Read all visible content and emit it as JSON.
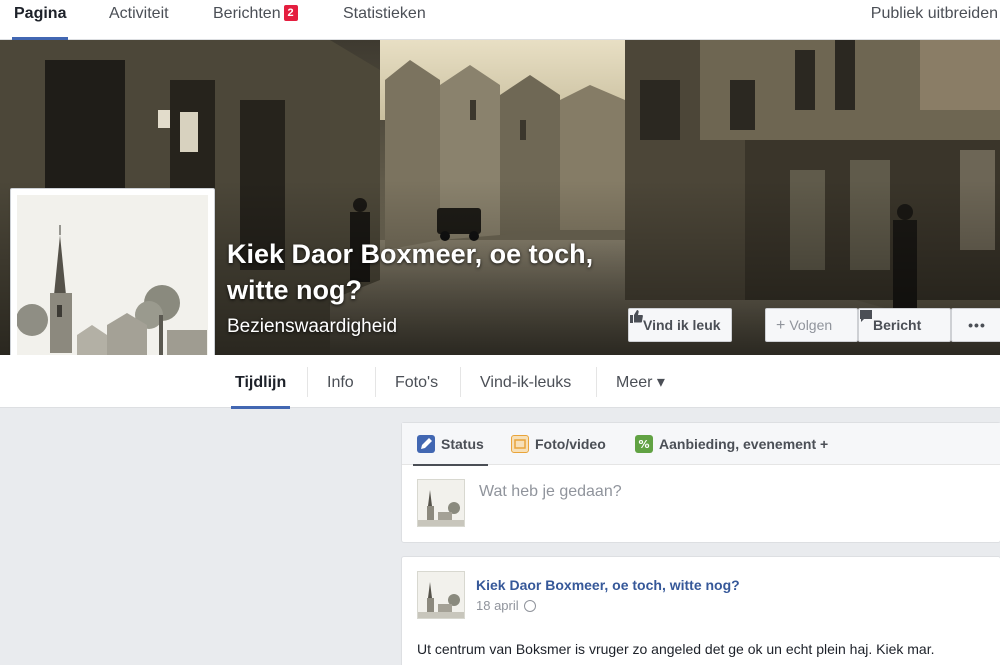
{
  "topnav": {
    "tabs": [
      {
        "label": "Pagina"
      },
      {
        "label": "Activiteit"
      },
      {
        "label": "Berichten",
        "badge": "2"
      },
      {
        "label": "Statistieken"
      }
    ],
    "publish_label": "Publiek uitbreiden"
  },
  "page": {
    "name": "Kiek Daor Boxmeer, oe toch, witte nog?",
    "category": "Bezienswaardigheid"
  },
  "cover_buttons": {
    "like": "Vind ik leuk",
    "follow": "Volgen",
    "message": "Bericht",
    "more": "•••"
  },
  "page_tabs": [
    {
      "label": "Tijdlijn"
    },
    {
      "label": "Info"
    },
    {
      "label": "Foto's"
    },
    {
      "label": "Vind-ik-leuks"
    },
    {
      "label": "Meer ▾"
    }
  ],
  "composer": {
    "tabs": [
      {
        "label": "Status",
        "color": "#4267b2"
      },
      {
        "label": "Foto/video",
        "color": "#e9a43a"
      },
      {
        "label": "Aanbieding, evenement +",
        "color": "#61a243"
      }
    ],
    "placeholder": "Wat heb je gedaan?"
  },
  "post": {
    "author": "Kiek Daor Boxmeer, oe toch, witte nog?",
    "date": "18 april",
    "text_line1": "Ut centrum van Boksmer is vruger zo angeled det ge ok un echt plein haj. Kiek mar.",
    "text_line2": ""
  },
  "colors": {
    "accent": "#4267b2",
    "link": "#365899",
    "badge": "#e41e3f"
  }
}
